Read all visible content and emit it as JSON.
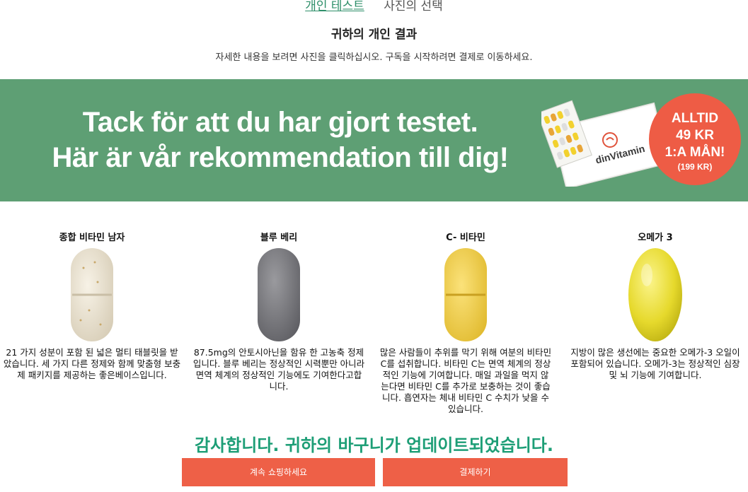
{
  "breadcrumb": {
    "link": "개인 테스트",
    "current": "사진의 선택"
  },
  "page_title": "귀하의 개인 결과",
  "subtitle": "자세한 내용을 보려면 사진을 클릭하십시오. 구독을 시작하려면 결제로 이동하세요.",
  "banner": {
    "line1": "Tack för att du har gjort testet.",
    "line2": "Här är vår rekommendation till dig!",
    "brand": "dinVitamin",
    "badge": {
      "line1": "ALLTID",
      "line2": "49 KR",
      "line3": "1:A MÅN!",
      "line4": "(199 KR)"
    }
  },
  "products": [
    {
      "name": "종합 비타민 남자",
      "description": "21 가지 성분이 포함 된 넓은 멀티 태블릿을 받았습니다. 세 가지 다른 정제와 함께 맞춤형 보충제 패키지를 제공하는 좋은베이스입니다."
    },
    {
      "name": "블루 베리",
      "description": "87.5mg의 안토시아닌을 함유 한 고농축 정제입니다. 블루 베리는 정상적인 시력뿐만 아니라 면역 체계의 정상적인 기능에도 기여한다고합니다."
    },
    {
      "name": "C- 비타민",
      "description": "많은 사람들이 추위를 막기 위해 여분의 비타민 C를 섭취합니다. 비타민 C는 면역 체계의 정상적인 기능에 기여합니다. 매일 과일을 먹지 않는다면 비타민 C를 추가로 보충하는 것이 좋습니다. 흡연자는 체내 비타민 C 수치가 낮을 수 있습니다."
    },
    {
      "name": "오메가 3",
      "description": "지방이 많은 생선에는 중요한 오메가-3 오일이 포함되어 있습니다. 오메가-3는 정상적인 심장 및 뇌 기능에 기여합니다."
    }
  ],
  "thanks_message": "감사합니다. 귀하의 바구니가 업데이트되었습니다.",
  "buttons": {
    "continue_shopping": "계속 쇼핑하세요",
    "checkout": "결제하기"
  },
  "colors": {
    "banner_green": "#5e9f74",
    "accent_red": "#ee6047",
    "thanks_green": "#1d9e76",
    "link_green": "#2f8f6a"
  }
}
